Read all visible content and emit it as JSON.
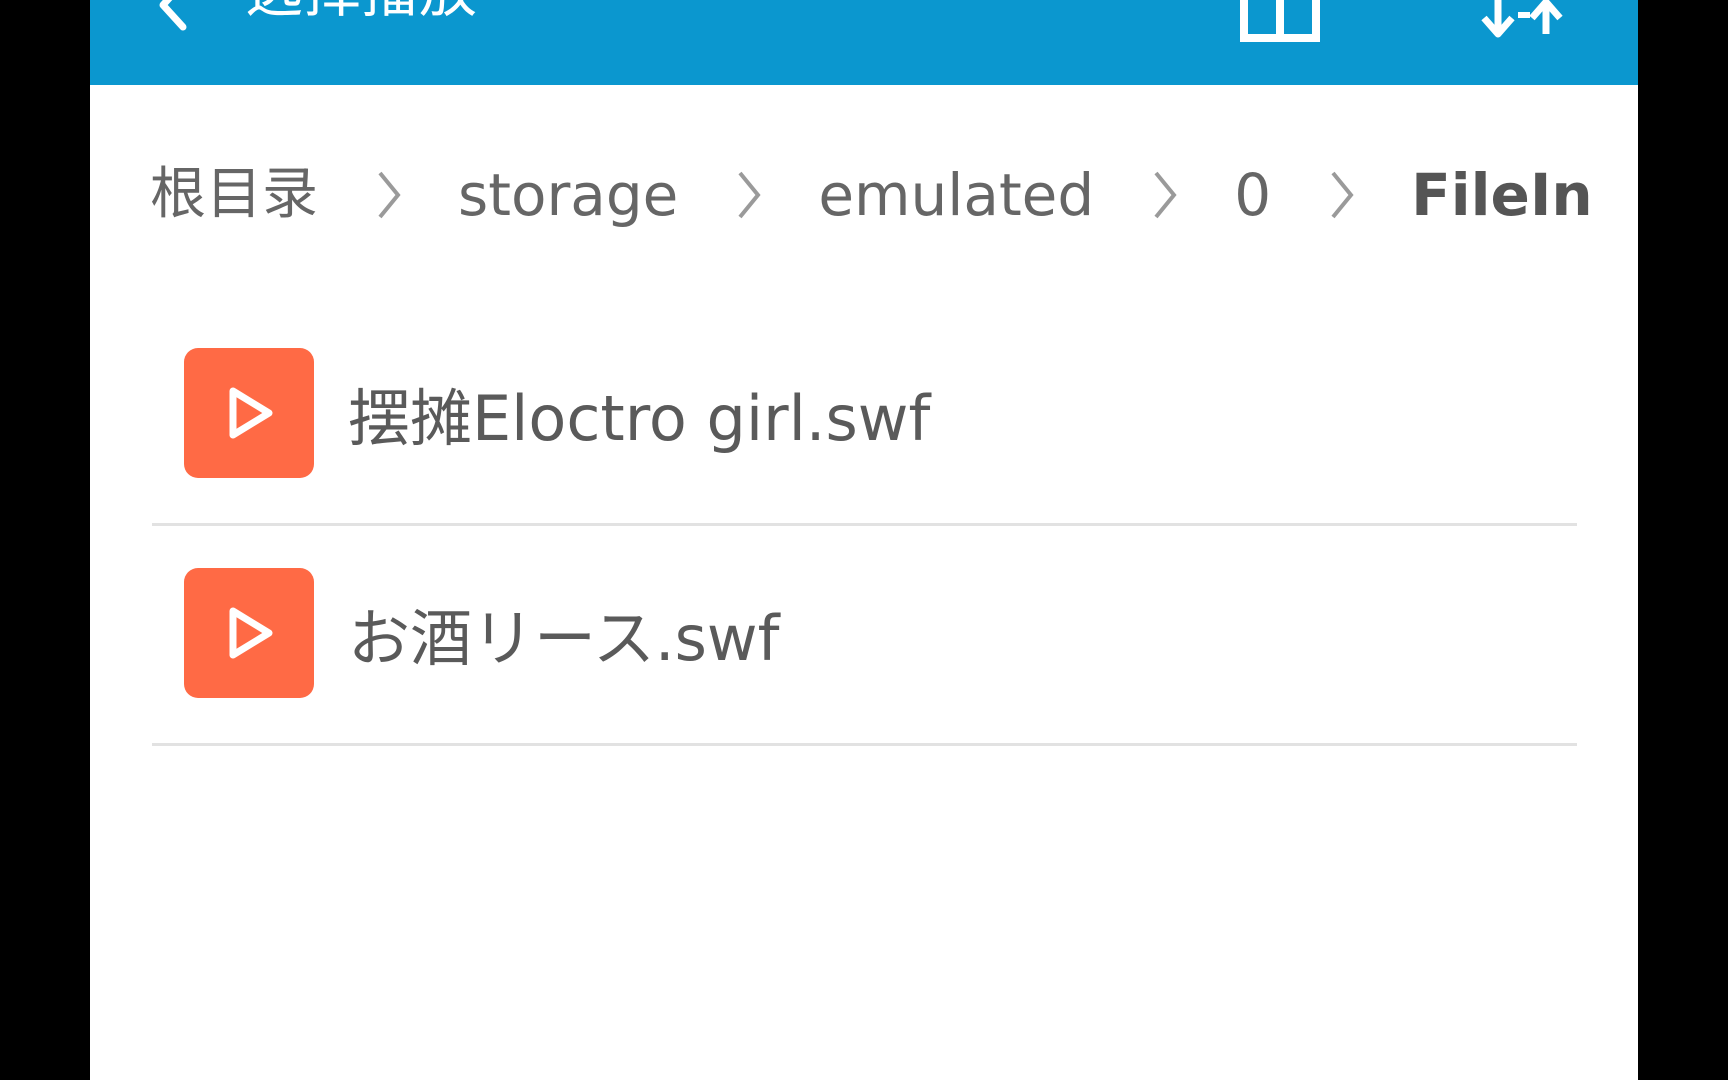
{
  "app_bar": {
    "title": "选择播放",
    "icons": [
      "back-arrow-icon",
      "grid-view-icon",
      "sort-icon"
    ],
    "color": "#0b97cf"
  },
  "breadcrumb": {
    "root": "根目录",
    "items": [
      "storage",
      "emulated",
      "0"
    ],
    "current": "FileIn",
    "separator_icon": "chevron-right-icon"
  },
  "files": [
    {
      "name": "摆摊Eloctro girl.swf",
      "icon": "play-icon"
    },
    {
      "name": "お酒リース.swf",
      "icon": "play-icon"
    }
  ],
  "colors": {
    "file_icon": "#ff6a45",
    "text": "#5a5a5a",
    "divider": "#e2e2e2"
  }
}
